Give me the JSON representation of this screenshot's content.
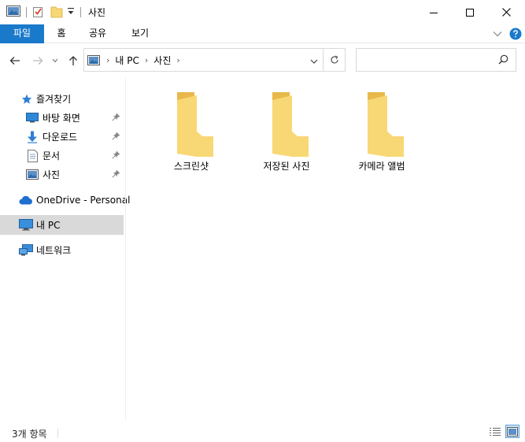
{
  "window": {
    "title": "사진"
  },
  "ribbon": {
    "tabs": [
      {
        "label": "파일"
      },
      {
        "label": "홈"
      },
      {
        "label": "공유"
      },
      {
        "label": "보기"
      }
    ]
  },
  "address": {
    "breadcrumbs": [
      "내 PC",
      "사진"
    ]
  },
  "search": {
    "placeholder": ""
  },
  "nav": {
    "quick_access": "즐겨찾기",
    "pinned": [
      {
        "label": "바탕 화면",
        "icon": "desktop-icon"
      },
      {
        "label": "다운로드",
        "icon": "download-icon"
      },
      {
        "label": "문서",
        "icon": "document-icon"
      },
      {
        "label": "사진",
        "icon": "pictures-icon"
      }
    ],
    "onedrive": "OneDrive - Personal",
    "this_pc": "내 PC",
    "network": "네트워크"
  },
  "content": {
    "folders": [
      {
        "name": "스크린샷"
      },
      {
        "name": "저장된 사진"
      },
      {
        "name": "카메라 앨범"
      }
    ]
  },
  "status": {
    "item_count": "3개 항목"
  },
  "colors": {
    "accent": "#1979ca",
    "folder_front": "#f8d775",
    "folder_back": "#e8b94a",
    "selected_nav": "#d9d9d9"
  }
}
